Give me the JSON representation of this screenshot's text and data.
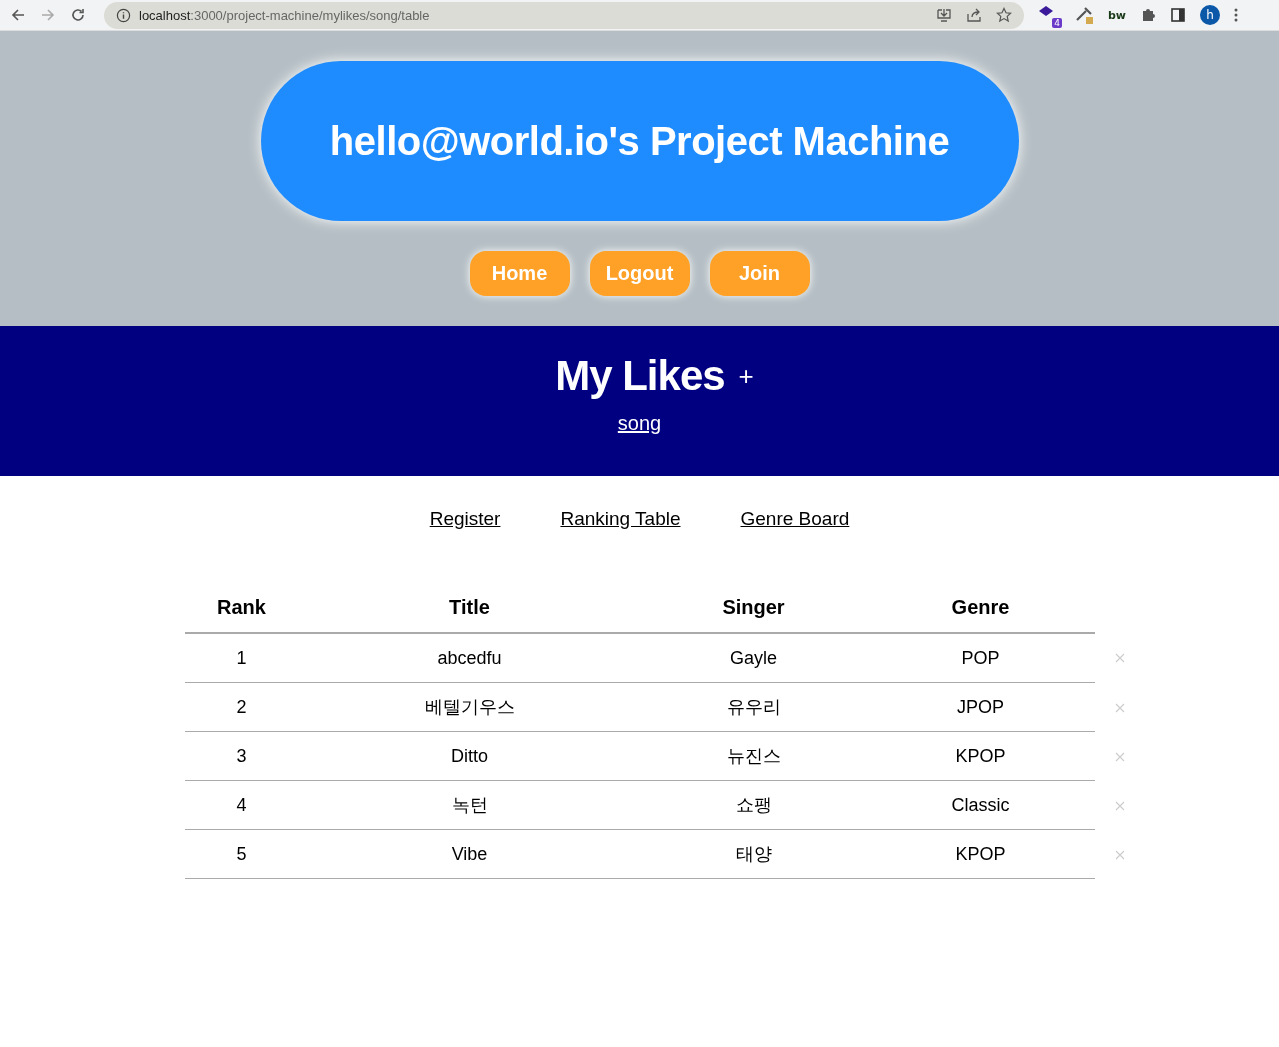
{
  "browser": {
    "url_host": "localhost",
    "url_rest": ":3000/project-machine/mylikes/song/table",
    "extension_badge": "4",
    "extension_label": "bw",
    "profile_initial": "h"
  },
  "header": {
    "title": "hello@world.io's Project Machine",
    "nav": [
      "Home",
      "Logout",
      "Join"
    ]
  },
  "banner": {
    "title": "My Likes",
    "add": "+",
    "category": "song"
  },
  "subnav": [
    "Register",
    "Ranking Table",
    "Genre Board"
  ],
  "table": {
    "columns": [
      "Rank",
      "Title",
      "Singer",
      "Genre"
    ],
    "rows": [
      {
        "rank": "1",
        "title": "abcedfu",
        "singer": "Gayle",
        "genre": "POP"
      },
      {
        "rank": "2",
        "title": "베텔기우스",
        "singer": "유우리",
        "genre": "JPOP"
      },
      {
        "rank": "3",
        "title": "Ditto",
        "singer": "뉴진스",
        "genre": "KPOP"
      },
      {
        "rank": "4",
        "title": "녹턴",
        "singer": "쇼팽",
        "genre": "Classic"
      },
      {
        "rank": "5",
        "title": "Vibe",
        "singer": "태양",
        "genre": "KPOP"
      }
    ]
  }
}
